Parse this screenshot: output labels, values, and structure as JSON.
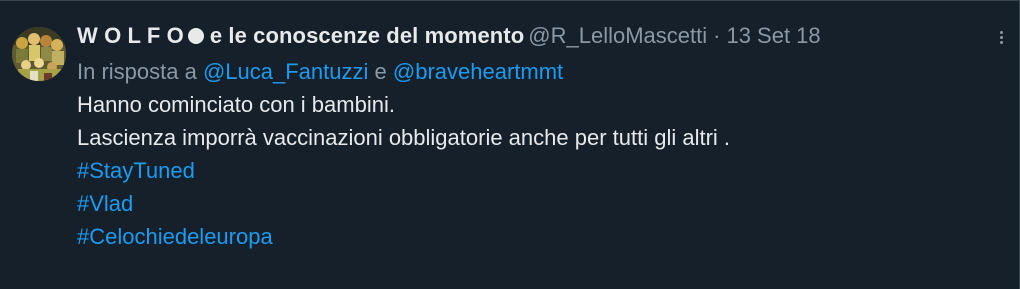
{
  "tweet": {
    "author": {
      "display_name": "W O L F O",
      "display_name_suffix": "e le conoscenze del momento",
      "emoji_icon": "black-circle-icon",
      "handle": "@R_LelloMascetti",
      "separator": "·",
      "date": "13 Set 18"
    },
    "reply": {
      "prefix": "In risposta a",
      "mention1": "@Luca_Fantuzzi",
      "conjunction": "e",
      "mention2": "@braveheartmmt"
    },
    "text_lines": [
      "Hanno cominciato con i bambini.",
      "Lascienza imporrà vaccinazioni obbligatorie anche per tutti gli altri ."
    ],
    "hashtags": [
      "#StayTuned",
      "#Vlad",
      "#Celochiedeleuropa"
    ],
    "more_icon": "more-options-icon"
  },
  "colors": {
    "background": "#15202b",
    "text": "#e7e9ea",
    "secondary": "#8b98a5",
    "link": "#1d9bf0"
  }
}
